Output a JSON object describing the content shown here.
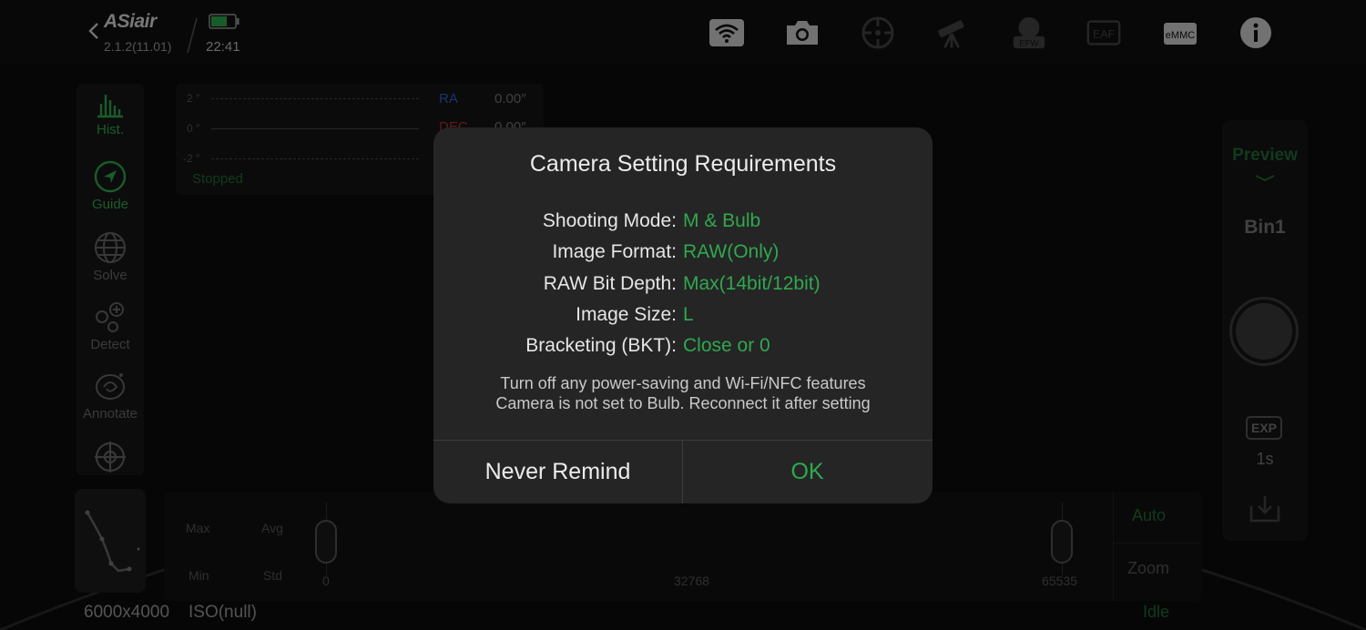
{
  "colors": {
    "accent_green": "#2fa84f",
    "ra_blue": "#2f5fd0",
    "dec_red": "#b03030"
  },
  "header": {
    "brand": "ASiair",
    "version": "2.1.2(11.01)",
    "time": "22:41",
    "battery_level": 0.6,
    "icons": [
      "wifi-icon",
      "camera-icon",
      "guide-scope-icon",
      "telescope-icon",
      "efw-icon",
      "eaf-icon",
      "emmc-icon",
      "info-icon"
    ],
    "efw_label": "EFW",
    "eaf_label": "EAF",
    "emmc_label": "eMMC"
  },
  "sidebar": {
    "items": [
      {
        "label": "Hist.",
        "icon": "histogram-icon"
      },
      {
        "label": "Guide",
        "icon": "guide-arrow-icon"
      },
      {
        "label": "Solve",
        "icon": "globe-icon"
      },
      {
        "label": "Detect",
        "icon": "detect-icon"
      },
      {
        "label": "Annotate",
        "icon": "galaxy-icon"
      },
      {
        "label": "",
        "icon": "crosshair-icon"
      }
    ]
  },
  "guide_graph": {
    "y_ticks": [
      "2 ″",
      "0 ″",
      "-2 ″"
    ],
    "ra_label": "RA",
    "ra_value": "0.00″",
    "dec_label": "DEC",
    "dec_value": "0.00″",
    "status": "Stopped"
  },
  "histogram": {
    "max_label": "Max",
    "avg_label": "Avg",
    "min_label": "Min",
    "std_label": "Std",
    "left_value": "0",
    "mid_value": "32768",
    "right_value": "65535",
    "auto_label": "Auto",
    "zoom_label": "Zoom",
    "state": "Idle"
  },
  "footer": {
    "resolution": "6000x4000",
    "iso": "ISO(null)"
  },
  "right_panel": {
    "preview_label": "Preview",
    "bin_label": "Bin1",
    "exp_badge": "EXP",
    "exp_value": "1s"
  },
  "dialog": {
    "title": "Camera Setting Requirements",
    "requirements": [
      {
        "label": "Shooting Mode:",
        "value": "M & Bulb"
      },
      {
        "label": "Image Format:",
        "value": "RAW(Only)"
      },
      {
        "label": "RAW Bit Depth:",
        "value": "Max(14bit/12bit)"
      },
      {
        "label": "Image Size:",
        "value": "L"
      },
      {
        "label": "Bracketing (BKT):",
        "value": "Close or 0"
      }
    ],
    "note_line1": "Turn off any power-saving and Wi-Fi/NFC features",
    "note_line2": "Camera is not set to Bulb. Reconnect it after setting",
    "never_remind_label": "Never Remind",
    "ok_label": "OK"
  }
}
